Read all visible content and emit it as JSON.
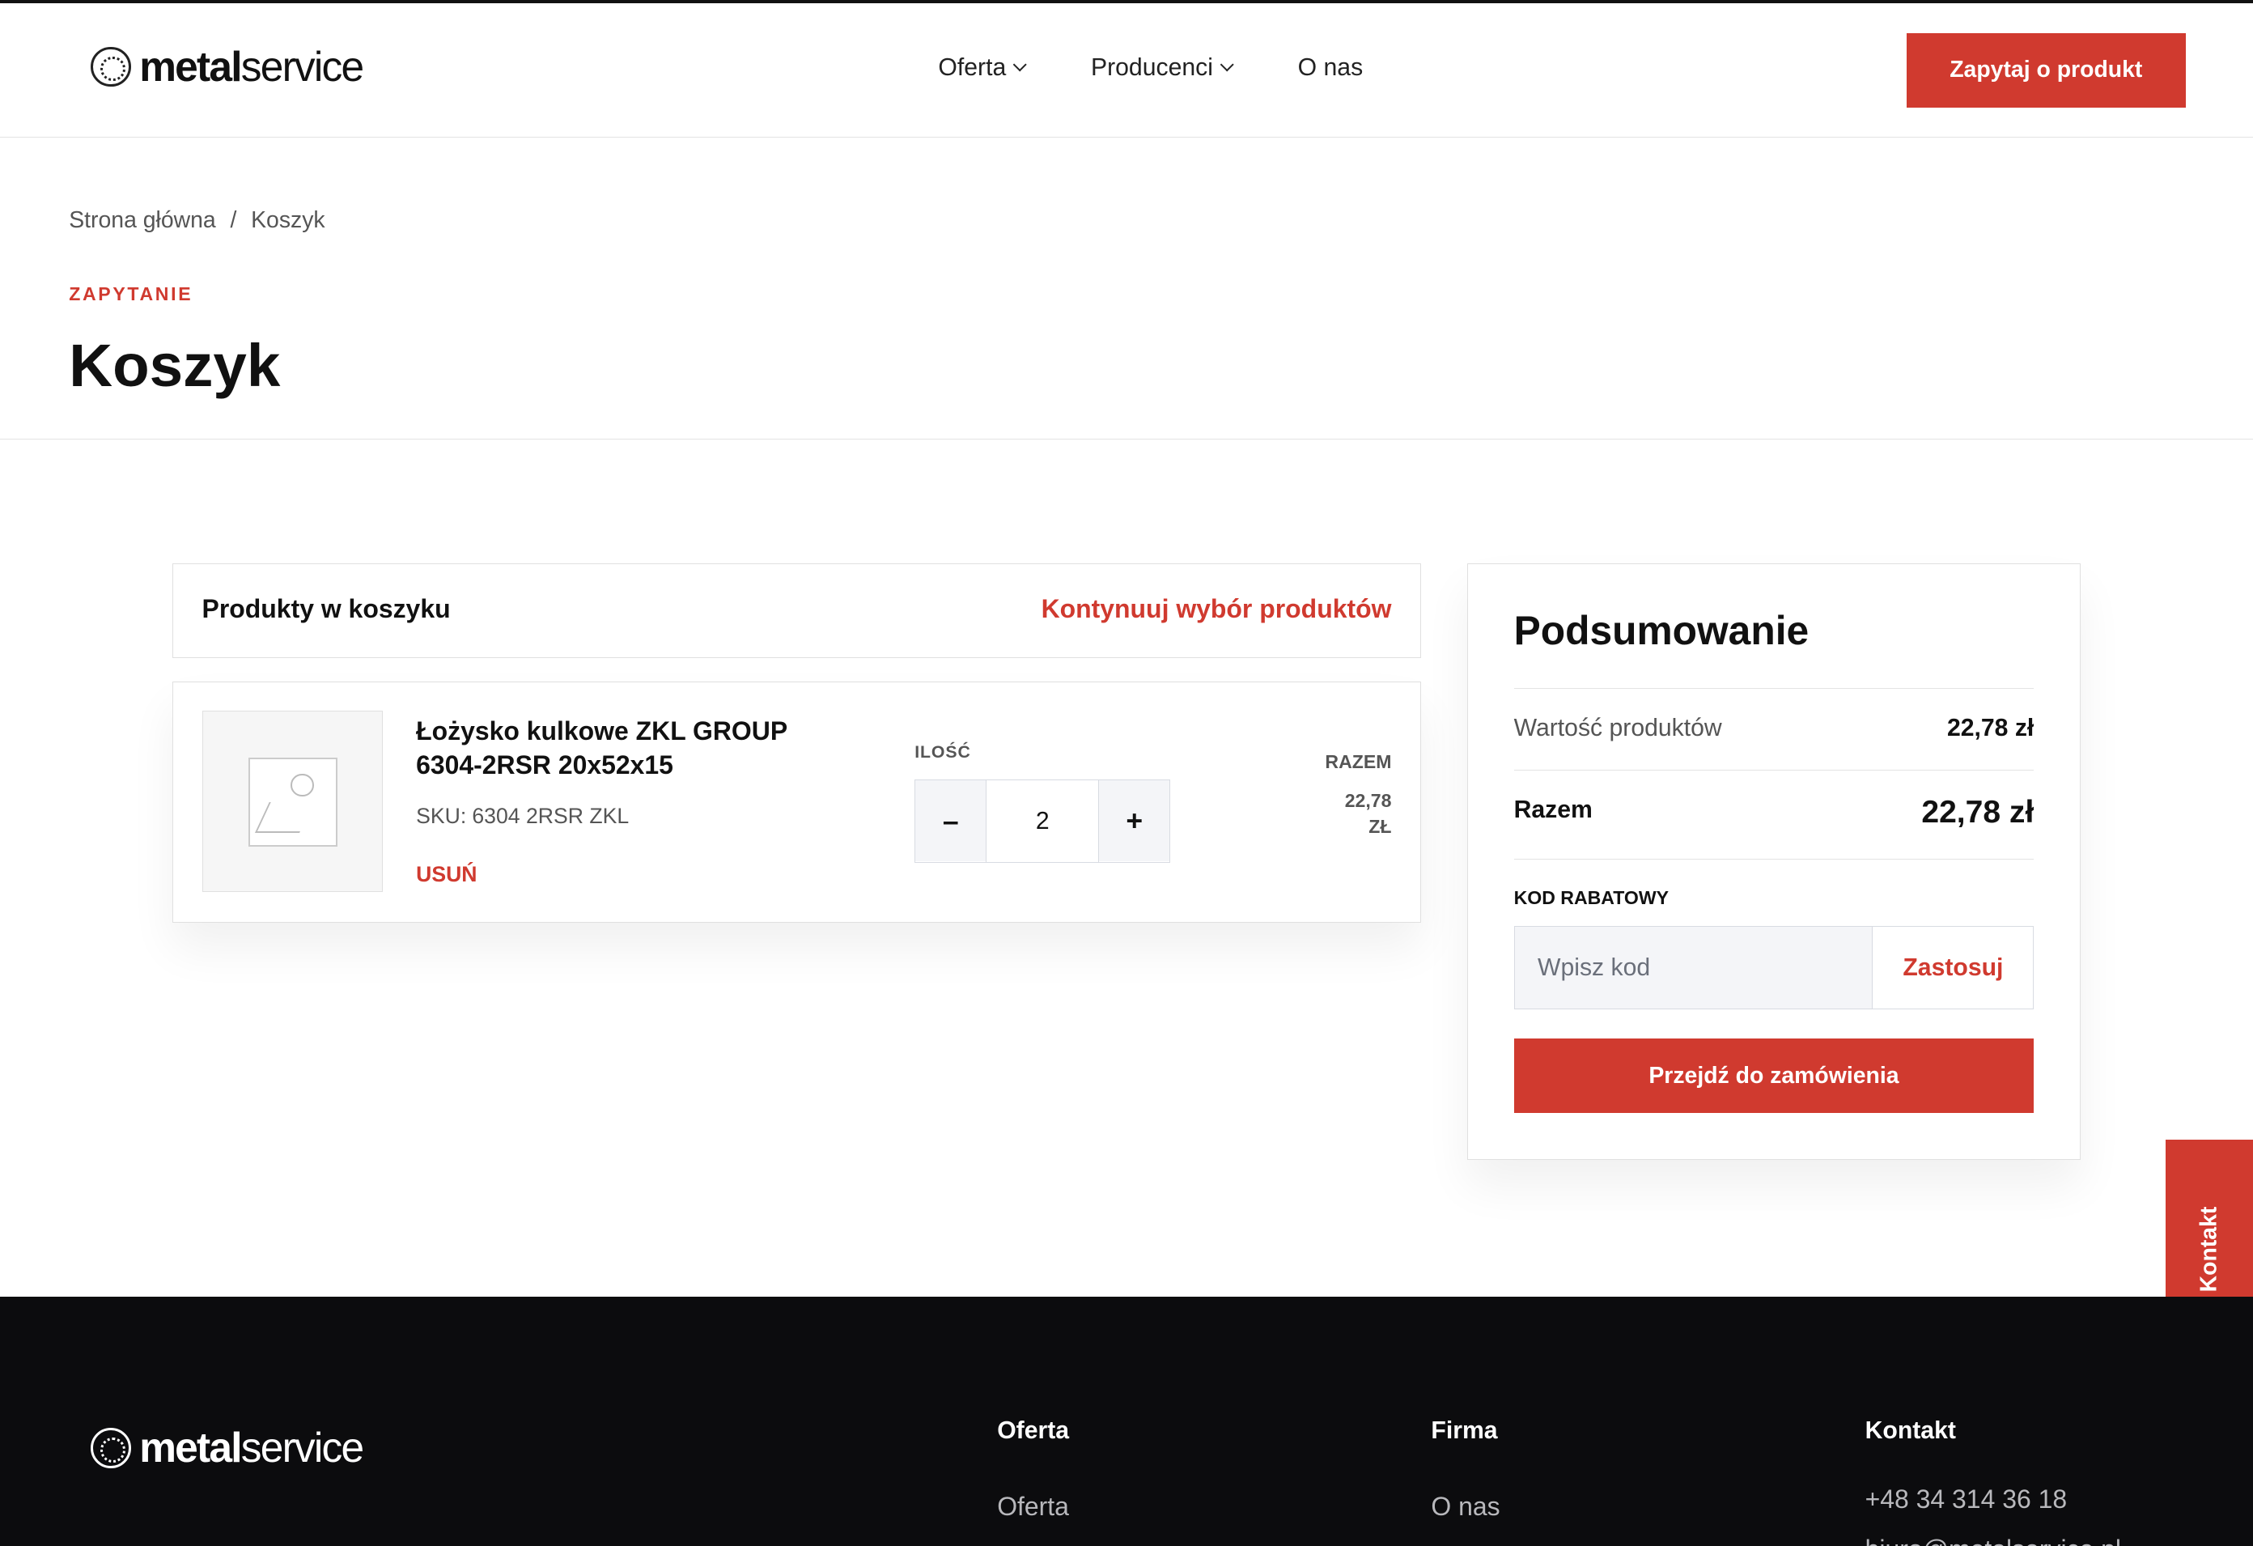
{
  "header": {
    "logo": {
      "bold": "metal",
      "light": "service"
    },
    "nav": [
      {
        "label": "Oferta",
        "dropdown": true
      },
      {
        "label": "Producenci",
        "dropdown": true
      },
      {
        "label": "O nas",
        "dropdown": false
      }
    ],
    "cta_label": "Zapytaj o produkt"
  },
  "breadcrumb": {
    "home": "Strona główna",
    "separator": "/",
    "current": "Koszyk"
  },
  "page": {
    "eyebrow": "ZAPYTANIE",
    "title": "Koszyk"
  },
  "cart": {
    "header_title": "Produkty w koszyku",
    "continue_link": "Kontynuuj wybór produktów",
    "items": [
      {
        "name": "Łożysko kulkowe ZKL GROUP 6304-2RSR 20x52x15",
        "sku_label": "SKU:",
        "sku": "6304 2RSR ZKL",
        "remove_label": "USUŃ",
        "quantity_label": "ILOŚĆ",
        "quantity": "2",
        "minus": "–",
        "plus": "+",
        "total_label": "RAZEM",
        "total_value": "22,78",
        "total_currency": "ZŁ"
      }
    ]
  },
  "summary": {
    "title": "Podsumowanie",
    "products_value_label": "Wartość produktów",
    "products_value": "22,78 zł",
    "total_label": "Razem",
    "total_value": "22,78 zł",
    "discount_label": "KOD RABATOWY",
    "discount_placeholder": "Wpisz kod",
    "discount_value": "",
    "apply_label": "Zastosuj",
    "checkout_label": "Przejdź do zamówienia"
  },
  "side_tab": {
    "label": "Kontakt"
  },
  "footer": {
    "logo": {
      "bold": "metal",
      "light": "service"
    },
    "columns": [
      {
        "heading": "Oferta",
        "links": [
          "Oferta"
        ]
      },
      {
        "heading": "Firma",
        "links": [
          "O nas"
        ]
      },
      {
        "heading": "Kontakt",
        "links": [
          "+48 34 314 36 18",
          "biuro@metalservice.pl"
        ]
      }
    ]
  },
  "colors": {
    "accent": "#d03a2f",
    "footer_bg": "#0c0c0e",
    "input_bg": "#f4f5f8"
  }
}
